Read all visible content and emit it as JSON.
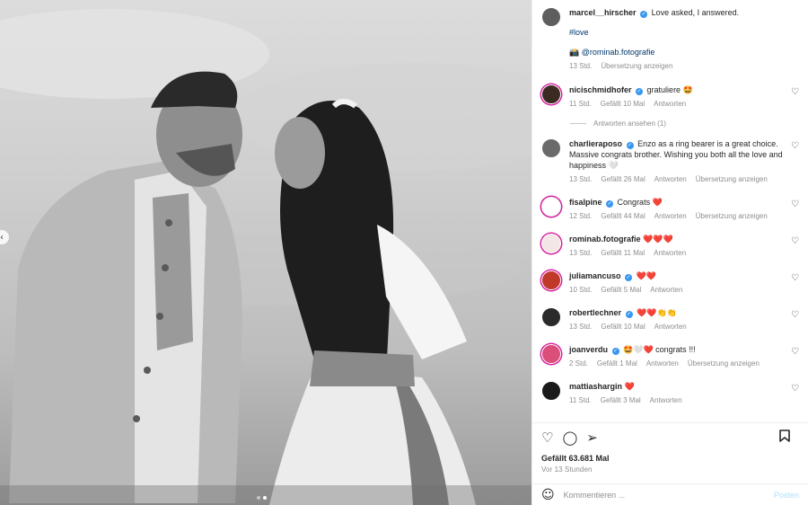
{
  "post": {
    "author": "marcel__hirscher",
    "caption": "Love asked, I answered.",
    "hashtag": "#love",
    "camera_icon": "📸",
    "photo_credit": "@rominab.fotografie",
    "time": "13 Std.",
    "translate": "Übersetzung anzeigen"
  },
  "comments": [
    {
      "user": "nicischmidhofer",
      "text": "gratuliere 🤩",
      "time": "11 Std.",
      "likes": "Gefällt 10 Mal",
      "reply": "Antworten",
      "translate": "",
      "avatar_color": "#3a2a22"
    },
    {
      "user": "charlieraposo",
      "text": "Enzo as a ring bearer is a great choice. Massive congrats brother. Wishing you both all the love and happiness 🤍",
      "time": "13 Std.",
      "likes": "Gefällt 26 Mal",
      "reply": "Antworten",
      "translate": "Übersetzung anzeigen",
      "avatar_color": "#6a6a6a"
    },
    {
      "user": "fisalpine",
      "text": "Congrats ❤️",
      "time": "12 Std.",
      "likes": "Gefällt 44 Mal",
      "reply": "Antworten",
      "translate": "Übersetzung anzeigen",
      "avatar_color": "#ffffff"
    },
    {
      "user": "rominab.fotografie",
      "text": "❤️❤️❤️",
      "time": "13 Std.",
      "likes": "Gefällt 11 Mal",
      "reply": "Antworten",
      "translate": "",
      "avatar_color": "#f3e6e6"
    },
    {
      "user": "juliamancuso",
      "text": "❤️❤️",
      "time": "10 Std.",
      "likes": "Gefällt 5 Mal",
      "reply": "Antworten",
      "translate": "",
      "avatar_color": "#c0392b"
    },
    {
      "user": "robertlechner",
      "text": "❤️❤️👏👏",
      "time": "13 Std.",
      "likes": "Gefällt 10 Mal",
      "reply": "Antworten",
      "translate": "",
      "avatar_color": "#2b2b2b"
    },
    {
      "user": "joanverdu",
      "text": "🤩🤍❤️ congrats !!!",
      "time": "2 Std.",
      "likes": "Gefällt 1 Mal",
      "reply": "Antworten",
      "translate": "Übersetzung anzeigen",
      "avatar_color": "#d94f7a"
    },
    {
      "user": "mattiashargin",
      "text": "❤️",
      "time": "11 Std.",
      "likes": "Gefällt 3 Mal",
      "reply": "Antworten",
      "translate": "",
      "avatar_color": "#1a1a1a"
    }
  ],
  "view_replies": "Antworten ansehen (1)",
  "actions": {
    "like_icon": "heart-icon",
    "comment_icon": "comment-icon",
    "share_icon": "paper-plane-icon",
    "save_icon": "bookmark-icon",
    "likes": "Gefällt 63.681 Mal",
    "ago": "Vor 13 Stunden"
  },
  "composer": {
    "placeholder": "Kommentieren ...",
    "post_label": "Posten"
  },
  "colors": {
    "link": "#00376b",
    "verified": "#3897f0",
    "post_button": "#b2dffc",
    "story_ring": "#d6249f"
  }
}
